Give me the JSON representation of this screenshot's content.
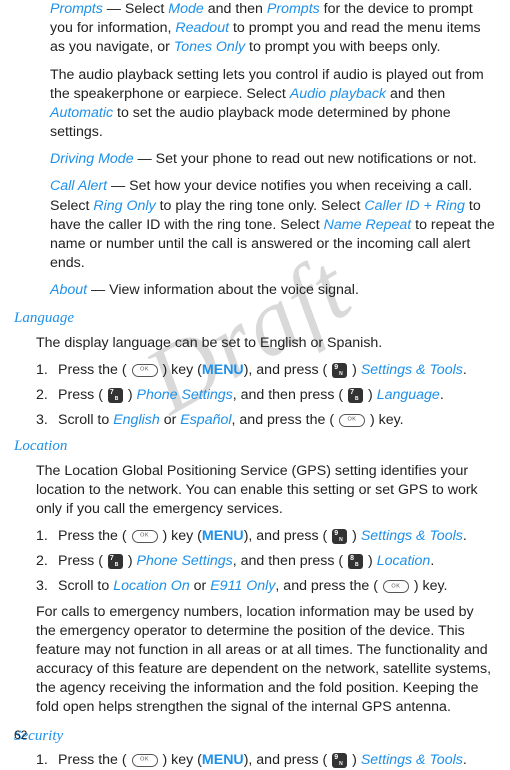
{
  "watermark": "Draft",
  "page_number": "62",
  "paragraphs": {
    "p1_a": "Prompts",
    "p1_b": " — Select ",
    "p1_c": "Mode",
    "p1_d": " and then ",
    "p1_e": "Prompts",
    "p1_f": " for the device to prompt you for information, ",
    "p1_g": "Readout",
    "p1_h": " to prompt you and read the menu items as you navigate, or ",
    "p1_i": "Tones Only",
    "p1_j": " to prompt you with beeps only.",
    "p2_a": "The audio playback setting lets you control if audio is played out from the speakerphone or earpiece. Select ",
    "p2_b": "Audio playback",
    "p2_c": " and then ",
    "p2_d": "Automatic",
    "p2_e": " to set the audio playback mode determined by phone settings.",
    "p3_a": "Driving Mode",
    "p3_b": " — Set your phone to read out new notifications or not.",
    "p4_a": "Call Alert",
    "p4_b": " — Set how your device notifies you when receiving a call. Select ",
    "p4_c": "Ring Only",
    "p4_d": " to play the ring tone only. Select ",
    "p4_e": "Caller ID + Ring",
    "p4_f": " to have the caller ID with the ring tone. Select ",
    "p4_g": "Name Repeat",
    "p4_h": " to repeat the name or number until the call is answered or the incoming call alert ends.",
    "p5_a": "About",
    "p5_b": " — View information about the voice signal."
  },
  "language": {
    "heading": "Language",
    "intro": "The display language can be set to English or Spanish.",
    "s1_a": "Press the ( ",
    "s1_b": " ) key (",
    "s1_c": "MENU",
    "s1_d": "), and press ( ",
    "s1_e": " ) ",
    "s1_f": "Settings & Tools",
    "s1_g": ".",
    "s2_a": "Press ( ",
    "s2_b": " ) ",
    "s2_c": "Phone Settings",
    "s2_d": ", and then press ( ",
    "s2_e": " ) ",
    "s2_f": "Language",
    "s2_g": ".",
    "s3_a": "Scroll to ",
    "s3_b": "English",
    "s3_c": " or ",
    "s3_d": "Español",
    "s3_e": ", and press the ( ",
    "s3_f": " ) key."
  },
  "location": {
    "heading": "Location",
    "intro": "The Location Global Positioning Service (GPS) setting identifies your location to the network. You can enable this setting or set GPS to work only if you call the emergency services.",
    "s1_a": "Press the ( ",
    "s1_b": " ) key (",
    "s1_c": "MENU",
    "s1_d": "), and press ( ",
    "s1_e": " ) ",
    "s1_f": "Settings & Tools",
    "s1_g": ".",
    "s2_a": "Press ( ",
    "s2_b": " ) ",
    "s2_c": "Phone Settings",
    "s2_d": ", and then press ( ",
    "s2_e": " ) ",
    "s2_f": "Location",
    "s2_g": ".",
    "s3_a": "Scroll to ",
    "s3_b": "Location On",
    "s3_c": " or ",
    "s3_d": "E911 Only",
    "s3_e": ", and press the ( ",
    "s3_f": " ) key.",
    "note": "For calls to emergency numbers, location information may be used by the emergency operator to determine the position of the device. This feature may not function in all areas or at all times. The functionality and accuracy of this feature are dependent on the network, satellite systems, the agency receiving the information and the fold position. Keeping the fold open helps strengthen the signal of the internal GPS antenna."
  },
  "security": {
    "heading": "Security",
    "s1_a": "Press the ( ",
    "s1_b": " ) key (",
    "s1_c": "MENU",
    "s1_d": "), and press ( ",
    "s1_e": " ) ",
    "s1_f": "Settings & Tools",
    "s1_g": "."
  },
  "icons": {
    "n9": "9",
    "n9s": "N",
    "n7": "7",
    "n7s": "B",
    "n8": "8",
    "n8s": "B"
  }
}
